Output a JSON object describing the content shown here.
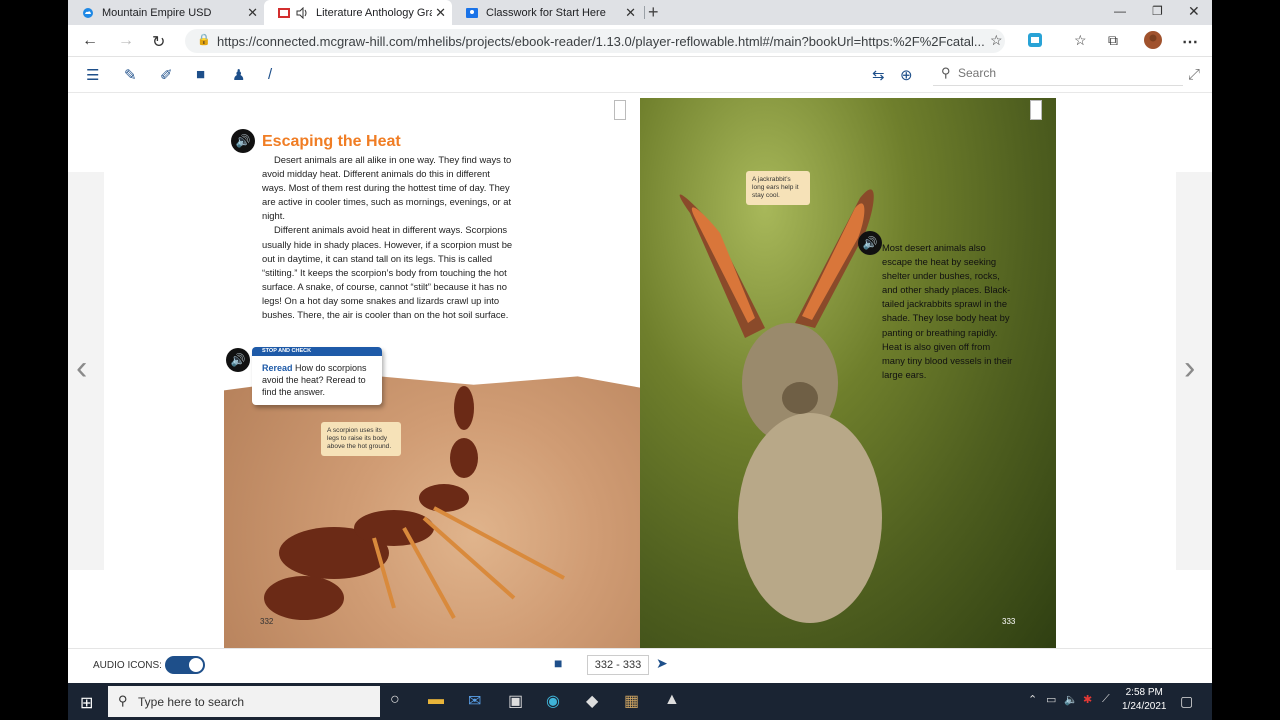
{
  "browser": {
    "tabs": [
      {
        "label": "Mountain Empire USD"
      },
      {
        "label": "Literature Anthology Grade"
      },
      {
        "label": "Classwork for Start Here"
      }
    ],
    "url": "https://connected.mcgraw-hill.com/mhelibs/projects/ebook-reader/1.13.0/player-reflowable.html#/main?bookUrl=https:%2F%2Fcatal..."
  },
  "reader": {
    "search_placeholder": "Search"
  },
  "page_left": {
    "heading": "Escaping the Heat",
    "para1": "Desert animals are all alike in one way. They find ways to avoid midday heat. Different animals do this in different ways. Most of them rest during the hottest time of day. They are active in cooler times, such as mornings, evenings, or at night.",
    "para2": "Different animals avoid heat in different ways. Scorpions usually hide in shady places. However, if a scorpion must be out in daytime, it can stand tall on its legs. This is called “stilting.” It keeps the scorpion’s body from touching the hot surface. A snake, of course, cannot “stilt” because it has no legs! On a hot day some snakes and lizards crawl up into bushes. There, the air is cooler than on the hot soil surface.",
    "stop_check_header": "STOP AND CHECK",
    "stop_check_strong": "Reread",
    "stop_check_text": " How do scorpions avoid the heat? Reread to find the answer.",
    "caption": "A scorpion uses its legs to raise its body above the hot ground.",
    "page_number": "332"
  },
  "page_right": {
    "caption": "A jackrabbit’s long ears help it stay cool.",
    "text": "Most desert animals also escape the heat by seeking shelter under bushes, rocks, and other shady places. Black-tailed jackrabbits sprawl in the shade. They lose body heat by panting or breathing rapidly. Heat is also given off from many tiny blood vessels in their large ears.",
    "page_number": "333"
  },
  "footer": {
    "audio_label": "AUDIO ICONS:",
    "audio_on": true,
    "page_range": "332 - 333"
  },
  "taskbar": {
    "search_text": "Type here to search",
    "time": "2:58 PM",
    "date": "1/24/2021"
  }
}
